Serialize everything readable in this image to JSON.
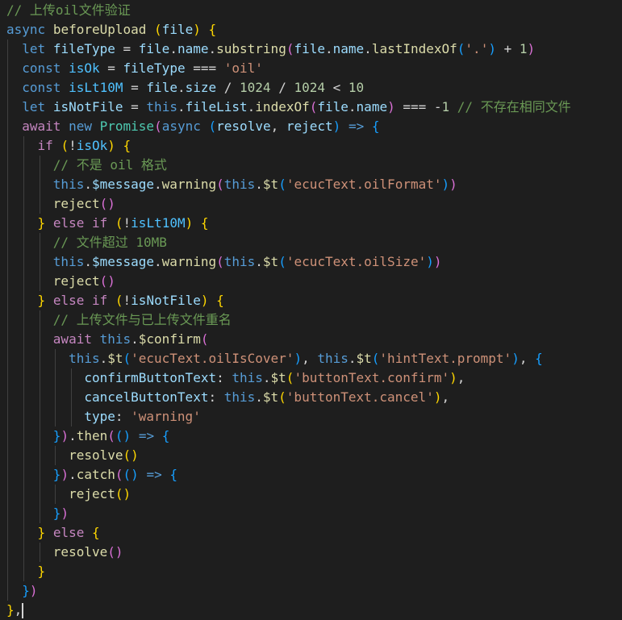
{
  "editor": {
    "language": "javascript",
    "theme_colors": {
      "background": "#1e1e1e",
      "comment": "#6a9955",
      "keyword": "#569cd6",
      "control": "#c586c0",
      "function": "#dcdcaa",
      "variable": "#9cdcfe",
      "constant": "#4fc1ff",
      "string": "#ce9178",
      "number": "#b5cea8",
      "class": "#4ec9b0",
      "plain": "#d4d4d4",
      "bracket1": "#ffd700",
      "bracket2": "#da70d6",
      "bracket3": "#179fff",
      "indent_guide": "#404040"
    },
    "lines": [
      {
        "indent": 0,
        "tokens": [
          [
            "comment",
            "// 上传oil文件验证"
          ]
        ]
      },
      {
        "indent": 0,
        "tokens": [
          [
            "keyword",
            "async"
          ],
          [
            "plain",
            " "
          ],
          [
            "function",
            "beforeUpload"
          ],
          [
            "plain",
            " "
          ],
          [
            "bracket1",
            "("
          ],
          [
            "variable",
            "file"
          ],
          [
            "bracket1",
            ")"
          ],
          [
            "plain",
            " "
          ],
          [
            "bracket1",
            "{"
          ]
        ]
      },
      {
        "indent": 1,
        "tokens": [
          [
            "keyword",
            "let"
          ],
          [
            "plain",
            " "
          ],
          [
            "variable",
            "fileType"
          ],
          [
            "plain",
            " = "
          ],
          [
            "variable",
            "file"
          ],
          [
            "plain",
            "."
          ],
          [
            "variable",
            "name"
          ],
          [
            "plain",
            "."
          ],
          [
            "function",
            "substring"
          ],
          [
            "bracket2",
            "("
          ],
          [
            "variable",
            "file"
          ],
          [
            "plain",
            "."
          ],
          [
            "variable",
            "name"
          ],
          [
            "plain",
            "."
          ],
          [
            "function",
            "lastIndexOf"
          ],
          [
            "bracket3",
            "("
          ],
          [
            "string",
            "'.'"
          ],
          [
            "bracket3",
            ")"
          ],
          [
            "plain",
            " + "
          ],
          [
            "number",
            "1"
          ],
          [
            "bracket2",
            ")"
          ]
        ]
      },
      {
        "indent": 1,
        "tokens": [
          [
            "keyword",
            "const"
          ],
          [
            "plain",
            " "
          ],
          [
            "const",
            "isOk"
          ],
          [
            "plain",
            " = "
          ],
          [
            "variable",
            "fileType"
          ],
          [
            "plain",
            " === "
          ],
          [
            "string",
            "'oil'"
          ]
        ]
      },
      {
        "indent": 1,
        "tokens": [
          [
            "keyword",
            "const"
          ],
          [
            "plain",
            " "
          ],
          [
            "const",
            "isLt10M"
          ],
          [
            "plain",
            " = "
          ],
          [
            "variable",
            "file"
          ],
          [
            "plain",
            "."
          ],
          [
            "variable",
            "size"
          ],
          [
            "plain",
            " / "
          ],
          [
            "number",
            "1024"
          ],
          [
            "plain",
            " / "
          ],
          [
            "number",
            "1024"
          ],
          [
            "plain",
            " < "
          ],
          [
            "number",
            "10"
          ]
        ]
      },
      {
        "indent": 1,
        "tokens": [
          [
            "keyword",
            "let"
          ],
          [
            "plain",
            " "
          ],
          [
            "variable",
            "isNotFile"
          ],
          [
            "plain",
            " = "
          ],
          [
            "keyword",
            "this"
          ],
          [
            "plain",
            "."
          ],
          [
            "variable",
            "fileList"
          ],
          [
            "plain",
            "."
          ],
          [
            "function",
            "indexOf"
          ],
          [
            "bracket2",
            "("
          ],
          [
            "variable",
            "file"
          ],
          [
            "plain",
            "."
          ],
          [
            "variable",
            "name"
          ],
          [
            "bracket2",
            ")"
          ],
          [
            "plain",
            " === -"
          ],
          [
            "number",
            "1"
          ],
          [
            "plain",
            " "
          ],
          [
            "comment",
            "// 不存在相同文件"
          ]
        ]
      },
      {
        "indent": 1,
        "tokens": [
          [
            "control",
            "await"
          ],
          [
            "plain",
            " "
          ],
          [
            "keyword",
            "new"
          ],
          [
            "plain",
            " "
          ],
          [
            "class",
            "Promise"
          ],
          [
            "bracket2",
            "("
          ],
          [
            "keyword",
            "async"
          ],
          [
            "plain",
            " "
          ],
          [
            "bracket3",
            "("
          ],
          [
            "variable",
            "resolve"
          ],
          [
            "plain",
            ", "
          ],
          [
            "variable",
            "reject"
          ],
          [
            "bracket3",
            ")"
          ],
          [
            "plain",
            " "
          ],
          [
            "keyword",
            "=>"
          ],
          [
            "plain",
            " "
          ],
          [
            "bracket3",
            "{"
          ]
        ]
      },
      {
        "indent": 2,
        "tokens": [
          [
            "control",
            "if"
          ],
          [
            "plain",
            " "
          ],
          [
            "bracket1",
            "("
          ],
          [
            "plain",
            "!"
          ],
          [
            "const",
            "isOk"
          ],
          [
            "bracket1",
            ")"
          ],
          [
            "plain",
            " "
          ],
          [
            "bracket1",
            "{"
          ]
        ]
      },
      {
        "indent": 3,
        "tokens": [
          [
            "comment",
            "// 不是 oil 格式"
          ]
        ]
      },
      {
        "indent": 3,
        "tokens": [
          [
            "keyword",
            "this"
          ],
          [
            "plain",
            "."
          ],
          [
            "variable",
            "$message"
          ],
          [
            "plain",
            "."
          ],
          [
            "function",
            "warning"
          ],
          [
            "bracket2",
            "("
          ],
          [
            "keyword",
            "this"
          ],
          [
            "plain",
            "."
          ],
          [
            "function",
            "$t"
          ],
          [
            "bracket3",
            "("
          ],
          [
            "string",
            "'ecucText.oilFormat'"
          ],
          [
            "bracket3",
            ")"
          ],
          [
            "bracket2",
            ")"
          ]
        ]
      },
      {
        "indent": 3,
        "tokens": [
          [
            "function",
            "reject"
          ],
          [
            "bracket2",
            "("
          ],
          [
            "bracket2",
            ")"
          ]
        ]
      },
      {
        "indent": 2,
        "tokens": [
          [
            "bracket1",
            "}"
          ],
          [
            "plain",
            " "
          ],
          [
            "control",
            "else"
          ],
          [
            "plain",
            " "
          ],
          [
            "control",
            "if"
          ],
          [
            "plain",
            " "
          ],
          [
            "bracket1",
            "("
          ],
          [
            "plain",
            "!"
          ],
          [
            "const",
            "isLt10M"
          ],
          [
            "bracket1",
            ")"
          ],
          [
            "plain",
            " "
          ],
          [
            "bracket1",
            "{"
          ]
        ]
      },
      {
        "indent": 3,
        "tokens": [
          [
            "comment",
            "// 文件超过 10MB"
          ]
        ]
      },
      {
        "indent": 3,
        "tokens": [
          [
            "keyword",
            "this"
          ],
          [
            "plain",
            "."
          ],
          [
            "variable",
            "$message"
          ],
          [
            "plain",
            "."
          ],
          [
            "function",
            "warning"
          ],
          [
            "bracket2",
            "("
          ],
          [
            "keyword",
            "this"
          ],
          [
            "plain",
            "."
          ],
          [
            "function",
            "$t"
          ],
          [
            "bracket3",
            "("
          ],
          [
            "string",
            "'ecucText.oilSize'"
          ],
          [
            "bracket3",
            ")"
          ],
          [
            "bracket2",
            ")"
          ]
        ]
      },
      {
        "indent": 3,
        "tokens": [
          [
            "function",
            "reject"
          ],
          [
            "bracket2",
            "("
          ],
          [
            "bracket2",
            ")"
          ]
        ]
      },
      {
        "indent": 2,
        "tokens": [
          [
            "bracket1",
            "}"
          ],
          [
            "plain",
            " "
          ],
          [
            "control",
            "else"
          ],
          [
            "plain",
            " "
          ],
          [
            "control",
            "if"
          ],
          [
            "plain",
            " "
          ],
          [
            "bracket1",
            "("
          ],
          [
            "plain",
            "!"
          ],
          [
            "variable",
            "isNotFile"
          ],
          [
            "bracket1",
            ")"
          ],
          [
            "plain",
            " "
          ],
          [
            "bracket1",
            "{"
          ]
        ]
      },
      {
        "indent": 3,
        "tokens": [
          [
            "comment",
            "// 上传文件与已上传文件重名"
          ]
        ]
      },
      {
        "indent": 3,
        "tokens": [
          [
            "control",
            "await"
          ],
          [
            "plain",
            " "
          ],
          [
            "keyword",
            "this"
          ],
          [
            "plain",
            "."
          ],
          [
            "function",
            "$confirm"
          ],
          [
            "bracket2",
            "("
          ]
        ]
      },
      {
        "indent": 4,
        "tokens": [
          [
            "keyword",
            "this"
          ],
          [
            "plain",
            "."
          ],
          [
            "function",
            "$t"
          ],
          [
            "bracket3",
            "("
          ],
          [
            "string",
            "'ecucText.oilIsCover'"
          ],
          [
            "bracket3",
            ")"
          ],
          [
            "plain",
            ", "
          ],
          [
            "keyword",
            "this"
          ],
          [
            "plain",
            "."
          ],
          [
            "function",
            "$t"
          ],
          [
            "bracket3",
            "("
          ],
          [
            "string",
            "'hintText.prompt'"
          ],
          [
            "bracket3",
            ")"
          ],
          [
            "plain",
            ", "
          ],
          [
            "bracket3",
            "{"
          ]
        ]
      },
      {
        "indent": 5,
        "tokens": [
          [
            "variable",
            "confirmButtonText"
          ],
          [
            "plain",
            ": "
          ],
          [
            "keyword",
            "this"
          ],
          [
            "plain",
            "."
          ],
          [
            "function",
            "$t"
          ],
          [
            "bracket1",
            "("
          ],
          [
            "string",
            "'buttonText.confirm'"
          ],
          [
            "bracket1",
            ")"
          ],
          [
            "plain",
            ","
          ]
        ]
      },
      {
        "indent": 5,
        "tokens": [
          [
            "variable",
            "cancelButtonText"
          ],
          [
            "plain",
            ": "
          ],
          [
            "keyword",
            "this"
          ],
          [
            "plain",
            "."
          ],
          [
            "function",
            "$t"
          ],
          [
            "bracket1",
            "("
          ],
          [
            "string",
            "'buttonText.cancel'"
          ],
          [
            "bracket1",
            ")"
          ],
          [
            "plain",
            ","
          ]
        ]
      },
      {
        "indent": 5,
        "tokens": [
          [
            "variable",
            "type"
          ],
          [
            "plain",
            ": "
          ],
          [
            "string",
            "'warning'"
          ]
        ]
      },
      {
        "indent": 3,
        "tokens": [
          [
            "bracket3",
            "}"
          ],
          [
            "bracket2",
            ")"
          ],
          [
            "plain",
            "."
          ],
          [
            "function",
            "then"
          ],
          [
            "bracket2",
            "("
          ],
          [
            "bracket3",
            "("
          ],
          [
            "bracket3",
            ")"
          ],
          [
            "plain",
            " "
          ],
          [
            "keyword",
            "=>"
          ],
          [
            "plain",
            " "
          ],
          [
            "bracket3",
            "{"
          ]
        ]
      },
      {
        "indent": 4,
        "tokens": [
          [
            "function",
            "resolve"
          ],
          [
            "bracket1",
            "("
          ],
          [
            "bracket1",
            ")"
          ]
        ]
      },
      {
        "indent": 3,
        "tokens": [
          [
            "bracket3",
            "}"
          ],
          [
            "bracket2",
            ")"
          ],
          [
            "plain",
            "."
          ],
          [
            "function",
            "catch"
          ],
          [
            "bracket2",
            "("
          ],
          [
            "bracket3",
            "("
          ],
          [
            "bracket3",
            ")"
          ],
          [
            "plain",
            " "
          ],
          [
            "keyword",
            "=>"
          ],
          [
            "plain",
            " "
          ],
          [
            "bracket3",
            "{"
          ]
        ]
      },
      {
        "indent": 4,
        "tokens": [
          [
            "function",
            "reject"
          ],
          [
            "bracket1",
            "("
          ],
          [
            "bracket1",
            ")"
          ]
        ]
      },
      {
        "indent": 3,
        "tokens": [
          [
            "bracket3",
            "}"
          ],
          [
            "bracket2",
            ")"
          ]
        ]
      },
      {
        "indent": 2,
        "tokens": [
          [
            "bracket1",
            "}"
          ],
          [
            "plain",
            " "
          ],
          [
            "control",
            "else"
          ],
          [
            "plain",
            " "
          ],
          [
            "bracket1",
            "{"
          ]
        ]
      },
      {
        "indent": 3,
        "tokens": [
          [
            "function",
            "resolve"
          ],
          [
            "bracket2",
            "("
          ],
          [
            "bracket2",
            ")"
          ]
        ]
      },
      {
        "indent": 2,
        "tokens": [
          [
            "bracket1",
            "}"
          ]
        ]
      },
      {
        "indent": 1,
        "tokens": [
          [
            "bracket3",
            "}"
          ],
          [
            "bracket2",
            ")"
          ]
        ]
      },
      {
        "indent": 0,
        "tokens": [
          [
            "bracket1",
            "}"
          ],
          [
            "plain",
            ","
          ]
        ],
        "cursor": true
      }
    ]
  }
}
